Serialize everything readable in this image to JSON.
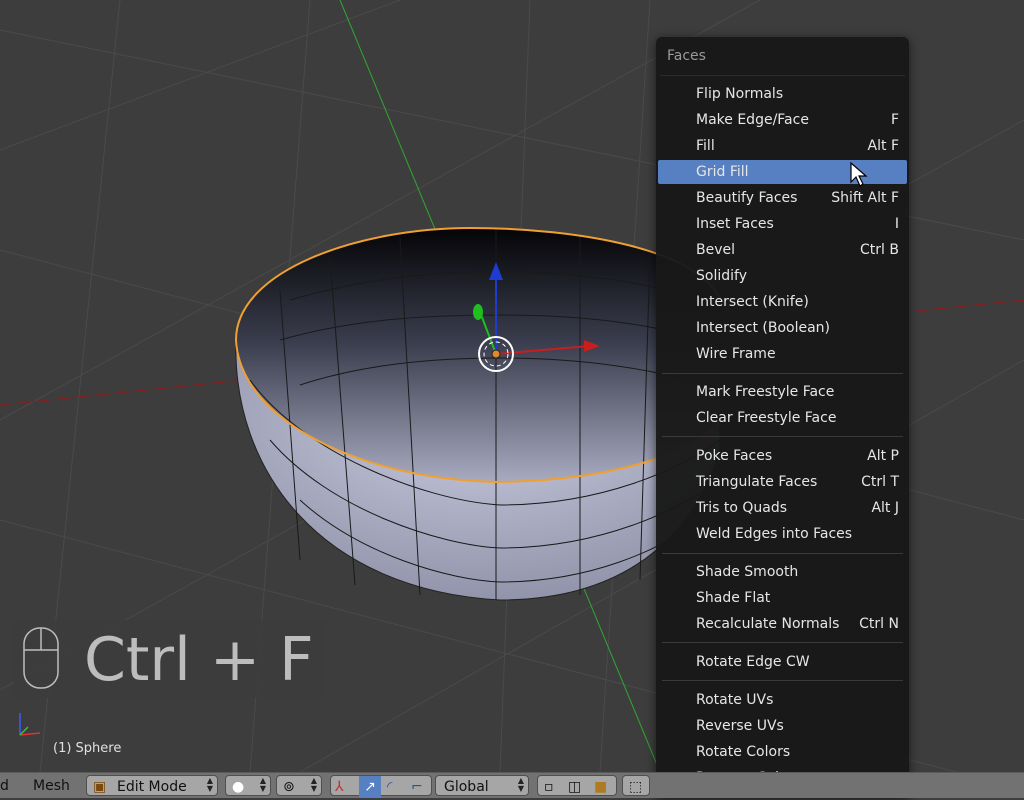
{
  "menu": {
    "title": "Faces",
    "items": [
      {
        "label": "Flip Normals",
        "shortcut": ""
      },
      {
        "label": "Make Edge/Face",
        "shortcut": "F"
      },
      {
        "label": "Fill",
        "shortcut": "Alt F"
      },
      {
        "label": "Grid Fill",
        "shortcut": ""
      },
      {
        "label": "Beautify Faces",
        "shortcut": "Shift Alt F"
      },
      {
        "label": "Inset Faces",
        "shortcut": "I"
      },
      {
        "label": "Bevel",
        "shortcut": "Ctrl B"
      },
      {
        "label": "Solidify",
        "shortcut": ""
      },
      {
        "label": "Intersect (Knife)",
        "shortcut": ""
      },
      {
        "label": "Intersect (Boolean)",
        "shortcut": ""
      },
      {
        "label": "Wire Frame",
        "shortcut": ""
      },
      {
        "label": "Mark Freestyle Face",
        "shortcut": ""
      },
      {
        "label": "Clear Freestyle Face",
        "shortcut": ""
      },
      {
        "label": "Poke Faces",
        "shortcut": "Alt P"
      },
      {
        "label": "Triangulate Faces",
        "shortcut": "Ctrl T"
      },
      {
        "label": "Tris to Quads",
        "shortcut": "Alt J"
      },
      {
        "label": "Weld Edges into Faces",
        "shortcut": ""
      },
      {
        "label": "Shade Smooth",
        "shortcut": ""
      },
      {
        "label": "Shade Flat",
        "shortcut": ""
      },
      {
        "label": "Recalculate Normals",
        "shortcut": "Ctrl N"
      },
      {
        "label": "Rotate Edge CW",
        "shortcut": ""
      },
      {
        "label": "Rotate UVs",
        "shortcut": ""
      },
      {
        "label": "Reverse UVs",
        "shortcut": ""
      },
      {
        "label": "Rotate Colors",
        "shortcut": ""
      },
      {
        "label": "Reverse Colors",
        "shortcut": ""
      }
    ],
    "highlighted": "Grid Fill"
  },
  "key_overlay": {
    "text": "Ctrl + F"
  },
  "viewport": {
    "object_label": "(1) Sphere"
  },
  "header": {
    "partial_label": "d",
    "mesh_menu": "Mesh",
    "mode": "Edit Mode",
    "orientation": "Global"
  },
  "colors": {
    "highlight": "#5680c2",
    "selection_edge": "#f0a030",
    "x_axis": "#c81e1e",
    "y_axis": "#1fbf1f",
    "z_axis": "#1e3cd0"
  }
}
